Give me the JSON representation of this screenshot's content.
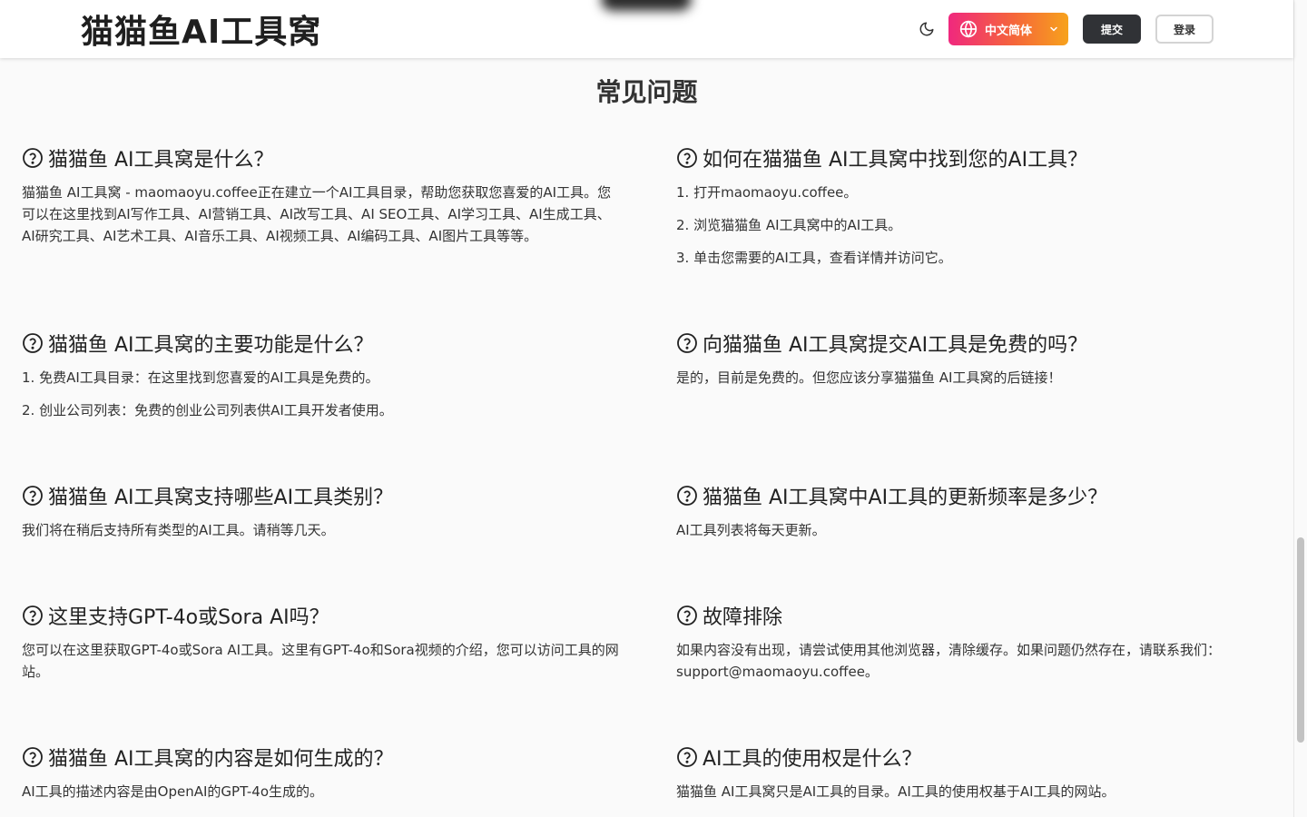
{
  "header": {
    "logo": "猫猫鱼AI工具窝",
    "language_label": "中文简体",
    "submit_label": "提交",
    "login_label": "登录"
  },
  "colors": {
    "gradient_start": "#f0287e",
    "gradient_end": "#f7a21c",
    "submit_bg": "#303236"
  },
  "faq": {
    "title": "常见问题",
    "items": [
      {
        "q": "猫猫鱼 AI工具窝是什么？",
        "a": [
          "猫猫鱼 AI工具窝 - maomaoyu.coffee正在建立一个AI工具目录，帮助您获取您喜爱的AI工具。您可以在这里找到AI写作工具、AI营销工具、AI改写工具、AI SEO工具、AI学习工具、AI生成工具、AI研究工具、AI艺术工具、AI音乐工具、AI视频工具、AI编码工具、AI图片工具等等。"
        ]
      },
      {
        "q": "如何在猫猫鱼 AI工具窝中找到您的AI工具？",
        "a": [
          "1. 打开maomaoyu.coffee。",
          "2. 浏览猫猫鱼 AI工具窝中的AI工具。",
          "3. 单击您需要的AI工具，查看详情并访问它。"
        ]
      },
      {
        "q": "猫猫鱼 AI工具窝的主要功能是什么？",
        "a": [
          "1. 免费AI工具目录：在这里找到您喜爱的AI工具是免费的。",
          "2. 创业公司列表：免费的创业公司列表供AI工具开发者使用。"
        ]
      },
      {
        "q": "向猫猫鱼 AI工具窝提交AI工具是免费的吗？",
        "a": [
          "是的，目前是免费的。但您应该分享猫猫鱼 AI工具窝的后链接！"
        ]
      },
      {
        "q": "猫猫鱼 AI工具窝支持哪些AI工具类别？",
        "a": [
          "我们将在稍后支持所有类型的AI工具。请稍等几天。"
        ]
      },
      {
        "q": "猫猫鱼 AI工具窝中AI工具的更新频率是多少？",
        "a": [
          "AI工具列表将每天更新。"
        ]
      },
      {
        "q": "这里支持GPT-4o或Sora AI吗？",
        "a": [
          "您可以在这里获取GPT-4o或Sora AI工具。这里有GPT-4o和Sora视频的介绍，您可以访问工具的网站。"
        ]
      },
      {
        "q": "故障排除",
        "a": [
          "如果内容没有出现，请尝试使用其他浏览器，清除缓存。如果问题仍然存在，请联系我们：support@maomaoyu.coffee。"
        ]
      },
      {
        "q": "猫猫鱼 AI工具窝的内容是如何生成的？",
        "a": [
          "AI工具的描述内容是由OpenAI的GPT-4o生成的。"
        ]
      },
      {
        "q": "AI工具的使用权是什么？",
        "a": [
          "猫猫鱼 AI工具窝只是AI工具的目录。AI工具的使用权基于AI工具的网站。"
        ]
      }
    ]
  }
}
